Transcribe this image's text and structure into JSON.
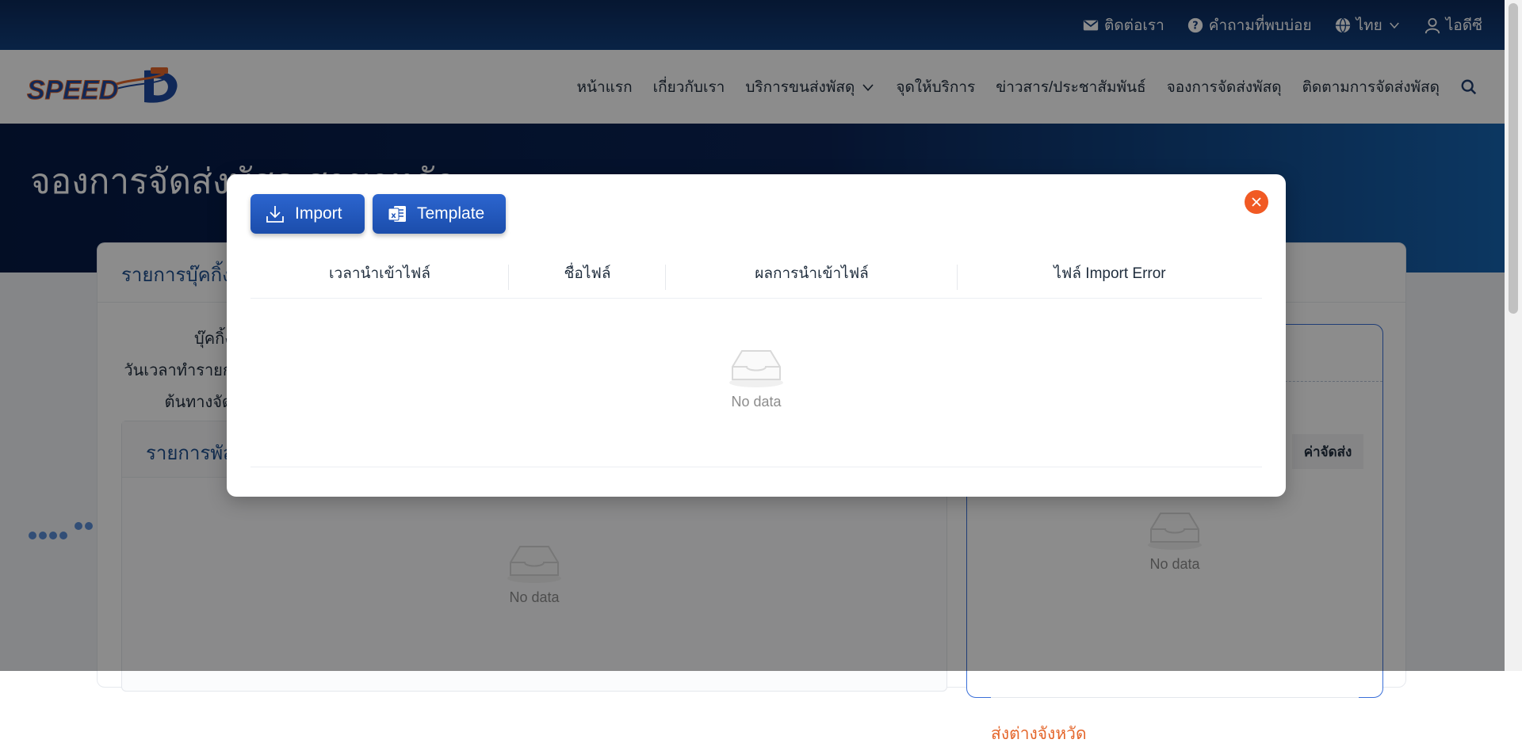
{
  "topbar": {
    "contact": "ติดต่อเรา",
    "faq": "คำถามที่พบบ่อย",
    "language": "ไทย",
    "user": "ไอดีซี"
  },
  "logo": {
    "text": "SPEED D"
  },
  "nav": {
    "items": [
      "หน้าแรก",
      "เกี่ยวกับเรา",
      "บริการขนส่งพัสดุ",
      "จุดให้บริการ",
      "ข่าวสาร/ประชาสัมพันธ์",
      "จองการจัดส่งพัสดุ",
      "ติดตามการจัดส่งพัสดุ"
    ]
  },
  "hero": {
    "title": "จองการจัดส่งพัสดุ สาขาหลัก"
  },
  "page": {
    "panel_title": "รายการบุ๊คกิ้ง",
    "labels": [
      "บุ๊คกิ้ง",
      "วันเวลาทำรายก",
      "ต้นทางจัด"
    ],
    "inner_title": "รายการพัส",
    "inner_empty": "No data",
    "right_col_header": "ค่าจัดส่ง",
    "right_empty": "No data",
    "right_section": "ส่งต่างจังหวัด"
  },
  "modal": {
    "import_label": "Import",
    "template_label": "Template",
    "columns": [
      "เวลานำเข้าไฟล์",
      "ชื่อไฟล์",
      "ผลการนำเข้าไฟล์",
      "ไฟล์ Import Error"
    ],
    "empty_text": "No data"
  },
  "colors": {
    "topbar": "#0c2a5a",
    "button": "#1f55b8",
    "close": "#f15a24",
    "title_blue": "#1e4f8f",
    "orange_text": "#e4662b"
  }
}
